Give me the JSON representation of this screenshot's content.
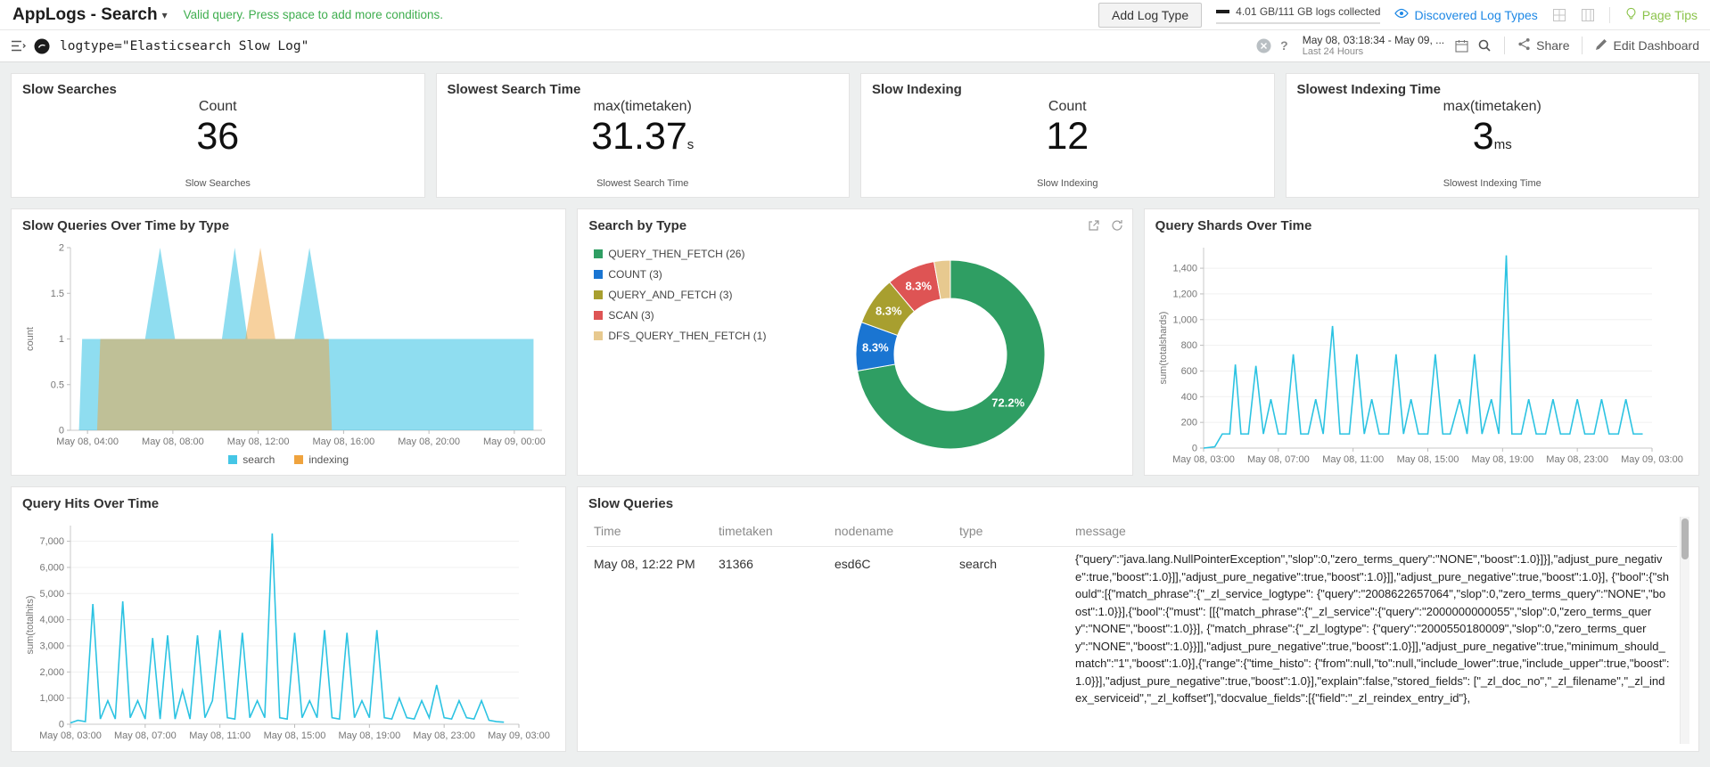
{
  "header": {
    "title": "AppLogs - Search",
    "query_status": "Valid query. Press space to add more conditions.",
    "add_log_type_label": "Add Log Type",
    "quota_text": "4.01 GB/111 GB logs collected",
    "discovered_log_types_label": "Discovered Log Types",
    "page_tips_label": "Page Tips"
  },
  "search_bar": {
    "query": "logtype=\"Elasticsearch Slow Log\"",
    "date_range": "May 08, 03:18:34 - May 09, ...",
    "date_range_preset": "Last 24 Hours",
    "share_label": "Share",
    "edit_dashboard_label": "Edit Dashboard"
  },
  "icons": {
    "caret_down": "▾",
    "help": "?"
  },
  "kpis": [
    {
      "title": "Slow Searches",
      "metric": "Count",
      "value": "36",
      "unit": "",
      "footer": "Slow Searches"
    },
    {
      "title": "Slowest Search Time",
      "metric": "max(timetaken)",
      "value": "31.37",
      "unit": "s",
      "footer": "Slowest Search Time"
    },
    {
      "title": "Slow Indexing",
      "metric": "Count",
      "value": "12",
      "unit": "",
      "footer": "Slow Indexing"
    },
    {
      "title": "Slowest Indexing Time",
      "metric": "max(timetaken)",
      "value": "3",
      "unit": "ms",
      "footer": "Slowest Indexing Time"
    }
  ],
  "chart_data": [
    {
      "type": "area",
      "title": "Slow Queries Over Time by Type",
      "ylabel": "count",
      "xlim": [
        3.2,
        25.3
      ],
      "ylim": [
        0,
        2
      ],
      "yticks": {
        "values": [
          0,
          0.5,
          1,
          1.5,
          2
        ],
        "labels": [
          "0",
          "0.5",
          "1",
          "1.5",
          "2"
        ]
      },
      "xticks": {
        "positions": [
          4,
          8,
          12,
          16,
          20,
          24
        ],
        "labels": [
          "May 08, 04:00",
          "May 08, 08:00",
          "May 08, 12:00",
          "May 08, 16:00",
          "May 08, 20:00",
          "May 09, 00:00"
        ]
      },
      "legend_position": "bottom",
      "series": [
        {
          "name": "search",
          "color": "#45c6e6",
          "fill_opacity": 0.6,
          "points": [
            [
              3.6,
              0
            ],
            [
              3.75,
              1
            ],
            [
              6.7,
              1
            ],
            [
              7.4,
              2
            ],
            [
              8.1,
              1
            ],
            [
              10.3,
              1
            ],
            [
              10.9,
              2
            ],
            [
              11.5,
              1
            ],
            [
              13.7,
              1
            ],
            [
              14.4,
              2
            ],
            [
              15.1,
              1
            ],
            [
              24.9,
              1
            ],
            [
              24.9,
              0
            ]
          ]
        },
        {
          "name": "indexing",
          "color": "#efa33e",
          "fill_opacity": 0.5,
          "points": [
            [
              4.45,
              0
            ],
            [
              4.6,
              1
            ],
            [
              11.4,
              1
            ],
            [
              12.1,
              2
            ],
            [
              12.8,
              1
            ],
            [
              15.3,
              1
            ],
            [
              15.45,
              0
            ]
          ]
        }
      ]
    },
    {
      "type": "donut",
      "title": "Search by Type",
      "slices": [
        {
          "label": "QUERY_THEN_FETCH (26)",
          "value": 26,
          "color": "#2f9e63",
          "pct_label": "72.2%"
        },
        {
          "label": "COUNT (3)",
          "value": 3,
          "color": "#1a75d2",
          "pct_label": "8.3%"
        },
        {
          "label": "QUERY_AND_FETCH (3)",
          "value": 3,
          "color": "#a89f2f",
          "pct_label": "8.3%"
        },
        {
          "label": "SCAN (3)",
          "value": 3,
          "color": "#de5454",
          "pct_label": "8.3%"
        },
        {
          "label": "DFS_QUERY_THEN_FETCH (1)",
          "value": 1,
          "color": "#e7c98f",
          "pct_label": ""
        }
      ]
    },
    {
      "type": "line",
      "title": "Query Shards Over Time",
      "ylabel": "sum(totalshards)",
      "color": "#2cc3e2",
      "grid": true,
      "xlim": [
        3,
        27
      ],
      "ylim": [
        0,
        1560
      ],
      "yticks": {
        "values": [
          0,
          200,
          400,
          600,
          800,
          1000,
          1200,
          1400
        ],
        "labels": [
          "0",
          "200",
          "400",
          "600",
          "800",
          "1,000",
          "1,200",
          "1,400"
        ]
      },
      "xticks": {
        "positions": [
          3,
          7,
          11,
          15,
          19,
          23,
          27
        ],
        "labels": [
          "May 08, 03:00",
          "May 08, 07:00",
          "May 08, 11:00",
          "May 08, 15:00",
          "May 08, 19:00",
          "May 08, 23:00",
          "May 09, 03:00"
        ]
      },
      "points": [
        [
          3,
          0
        ],
        [
          3.6,
          10
        ],
        [
          4,
          110
        ],
        [
          4.4,
          110
        ],
        [
          4.7,
          650
        ],
        [
          5,
          110
        ],
        [
          5.4,
          110
        ],
        [
          5.8,
          640
        ],
        [
          6.2,
          110
        ],
        [
          6.6,
          380
        ],
        [
          7,
          110
        ],
        [
          7.4,
          110
        ],
        [
          7.8,
          730
        ],
        [
          8.2,
          110
        ],
        [
          8.6,
          110
        ],
        [
          9,
          380
        ],
        [
          9.4,
          110
        ],
        [
          9.9,
          950
        ],
        [
          10.3,
          110
        ],
        [
          10.8,
          110
        ],
        [
          11.2,
          730
        ],
        [
          11.6,
          110
        ],
        [
          12,
          380
        ],
        [
          12.4,
          110
        ],
        [
          12.9,
          110
        ],
        [
          13.3,
          730
        ],
        [
          13.7,
          110
        ],
        [
          14.1,
          380
        ],
        [
          14.5,
          110
        ],
        [
          15,
          110
        ],
        [
          15.4,
          730
        ],
        [
          15.8,
          110
        ],
        [
          16.2,
          110
        ],
        [
          16.7,
          380
        ],
        [
          17.1,
          110
        ],
        [
          17.5,
          730
        ],
        [
          17.9,
          110
        ],
        [
          18.4,
          380
        ],
        [
          18.8,
          110
        ],
        [
          19.2,
          1500
        ],
        [
          19.5,
          110
        ],
        [
          20,
          110
        ],
        [
          20.4,
          380
        ],
        [
          20.8,
          110
        ],
        [
          21.3,
          110
        ],
        [
          21.7,
          380
        ],
        [
          22.1,
          110
        ],
        [
          22.6,
          110
        ],
        [
          23,
          380
        ],
        [
          23.4,
          110
        ],
        [
          23.9,
          110
        ],
        [
          24.3,
          380
        ],
        [
          24.7,
          110
        ],
        [
          25.2,
          110
        ],
        [
          25.6,
          380
        ],
        [
          26,
          110
        ],
        [
          26.5,
          110
        ]
      ]
    },
    {
      "type": "line",
      "title": "Query Hits Over Time",
      "ylabel": "sum(totalhits)",
      "color": "#2cc3e2",
      "grid": true,
      "xlim": [
        3,
        27
      ],
      "ylim": [
        0,
        7600
      ],
      "yticks": {
        "values": [
          0,
          1000,
          2000,
          3000,
          4000,
          5000,
          6000,
          7000
        ],
        "labels": [
          "0",
          "1,000",
          "2,000",
          "3,000",
          "4,000",
          "5,000",
          "6,000",
          "7,000"
        ]
      },
      "xticks": {
        "positions": [
          3,
          7,
          11,
          15,
          19,
          23,
          27
        ],
        "labels": [
          "May 08, 03:00",
          "May 08, 07:00",
          "May 08, 11:00",
          "May 08, 15:00",
          "May 08, 19:00",
          "May 08, 23:00",
          "May 09, 03:00"
        ]
      },
      "points": [
        [
          3,
          50
        ],
        [
          3.4,
          150
        ],
        [
          3.8,
          100
        ],
        [
          4.2,
          4600
        ],
        [
          4.6,
          200
        ],
        [
          5,
          900
        ],
        [
          5.4,
          200
        ],
        [
          5.8,
          4700
        ],
        [
          6.2,
          250
        ],
        [
          6.6,
          900
        ],
        [
          7,
          200
        ],
        [
          7.4,
          3300
        ],
        [
          7.8,
          200
        ],
        [
          8.2,
          3400
        ],
        [
          8.6,
          200
        ],
        [
          9,
          1300
        ],
        [
          9.4,
          200
        ],
        [
          9.8,
          3400
        ],
        [
          10.2,
          250
        ],
        [
          10.6,
          900
        ],
        [
          11,
          3600
        ],
        [
          11.4,
          250
        ],
        [
          11.8,
          200
        ],
        [
          12.2,
          3500
        ],
        [
          12.6,
          250
        ],
        [
          13,
          900
        ],
        [
          13.4,
          250
        ],
        [
          13.8,
          7300
        ],
        [
          14.2,
          250
        ],
        [
          14.6,
          200
        ],
        [
          15,
          3500
        ],
        [
          15.4,
          250
        ],
        [
          15.8,
          900
        ],
        [
          16.2,
          250
        ],
        [
          16.6,
          3600
        ],
        [
          17,
          250
        ],
        [
          17.4,
          200
        ],
        [
          17.8,
          3500
        ],
        [
          18.2,
          250
        ],
        [
          18.6,
          900
        ],
        [
          19,
          250
        ],
        [
          19.4,
          3600
        ],
        [
          19.8,
          250
        ],
        [
          20.2,
          200
        ],
        [
          20.6,
          1000
        ],
        [
          21,
          250
        ],
        [
          21.4,
          200
        ],
        [
          21.8,
          900
        ],
        [
          22.2,
          250
        ],
        [
          22.6,
          1500
        ],
        [
          23,
          250
        ],
        [
          23.4,
          200
        ],
        [
          23.8,
          900
        ],
        [
          24.2,
          250
        ],
        [
          24.6,
          200
        ],
        [
          25,
          900
        ],
        [
          25.4,
          150
        ],
        [
          25.8,
          100
        ],
        [
          26.2,
          80
        ]
      ]
    }
  ],
  "table": {
    "title": "Slow Queries",
    "columns": [
      "Time",
      "timetaken",
      "nodename",
      "type",
      "message"
    ],
    "rows": [
      {
        "time": "May 08, 12:22 PM",
        "timetaken": "31366",
        "nodename": "esd6C",
        "type": "search",
        "message": "{\"query\":\"java.lang.NullPointerException\",\"slop\":0,\"zero_terms_query\":\"NONE\",\"boost\":1.0}]}],\"adjust_pure_negative\":true,\"boost\":1.0}]],\"adjust_pure_negative\":true,\"boost\":1.0}]],\"adjust_pure_negative\":true,\"boost\":1.0}], {\"bool\":{\"should\":[{\"match_phrase\":{\"_zl_service_logtype\": {\"query\":\"2008622657064\",\"slop\":0,\"zero_terms_query\":\"NONE\",\"boost\":1.0}}],{\"bool\":{\"must\": [[{\"match_phrase\":{\"_zl_service\":{\"query\":\"2000000000055\",\"slop\":0,\"zero_terms_query\":\"NONE\",\"boost\":1.0}}], {\"match_phrase\":{\"_zl_logtype\": {\"query\":\"2000550180009\",\"slop\":0,\"zero_terms_query\":\"NONE\",\"boost\":1.0}}]],\"adjust_pure_negative\":true,\"boost\":1.0}]],\"adjust_pure_negative\":true,\"minimum_should_match\":\"1\",\"boost\":1.0}],{\"range\":{\"time_histo\": {\"from\":null,\"to\":null,\"include_lower\":true,\"include_upper\":true,\"boost\":1.0}}],\"adjust_pure_negative\":true,\"boost\":1.0}],\"explain\":false,\"stored_fields\": [\"_zl_doc_no\",\"_zl_filename\",\"_zl_index_serviceid\",\"_zl_koffset\"],\"docvalue_fields\":[{\"field\":\"_zl_reindex_entry_id\"},"
      }
    ]
  }
}
